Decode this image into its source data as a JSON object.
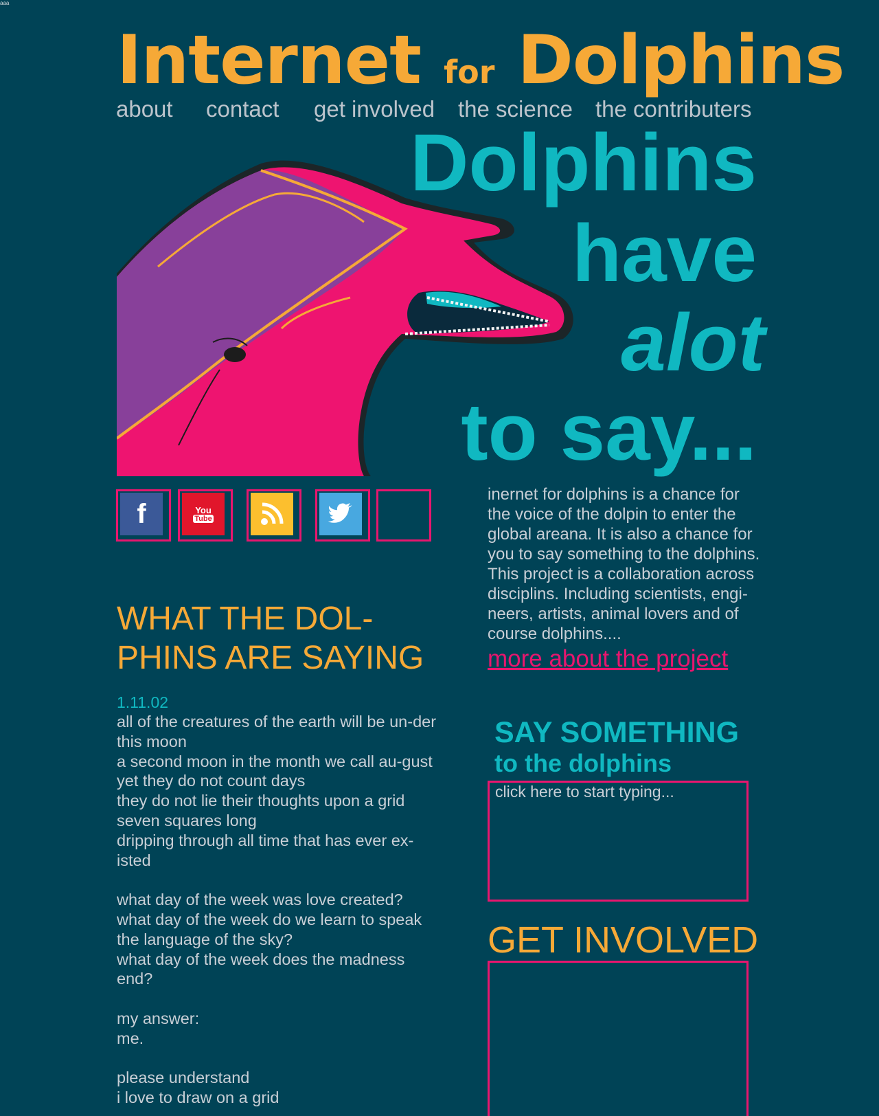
{
  "corner_text": "aaa",
  "logo": {
    "word1": "Internet",
    "word2": "for",
    "word3": "Dolphins"
  },
  "nav": [
    {
      "label": "about"
    },
    {
      "label": "contact"
    },
    {
      "label": "get involved"
    },
    {
      "label": "the science"
    },
    {
      "label": "the contributers"
    }
  ],
  "headline": {
    "line1": "Dolphins",
    "line2": "have",
    "line3": "alot",
    "line4": "to say..."
  },
  "social": [
    {
      "icon": "facebook-icon",
      "color": "#3b5998",
      "glyph": "f"
    },
    {
      "icon": "youtube-icon",
      "color": "#e1162b",
      "glyph_top": "You",
      "glyph_bottom": "Tube"
    },
    {
      "icon": "rss-icon",
      "color": "#fcbf2e"
    },
    {
      "icon": "twitter-icon",
      "color": "#48a8e0"
    },
    {
      "icon": "empty-slot"
    }
  ],
  "intro": {
    "text": "inernet for dolphins is a chance for the voice of the dolpin to enter the global areana. It is also a chance for you to say something to the dolphins. This project is a collaboration across disciplins. Including scientists, engi-neers, artists, animal lovers and of course dolphins....",
    "link": "more about the project"
  },
  "feed": {
    "title": "WHAT THE DOL-PHINS ARE SAYING",
    "date": "1.11.02",
    "poem": "all of the creatures of the earth will be un-der this moon\na second moon in the month we call au-gust\nyet they do not count days\nthey do not lie their thoughts upon a grid seven squares long\ndripping through all time that has ever ex-isted\n\nwhat day of the week was love created?\nwhat day of the week do we learn to speak the language of the sky?\nwhat day of the week does the madness end?\n\nmy answer:\nme.\n\nplease understand\ni love to draw on a grid"
  },
  "say": {
    "title": "SAY SOMETHING",
    "subtitle": "to the dolphins",
    "placeholder": "click here to start typing..."
  },
  "get_involved": {
    "title": "GET INVOLVED"
  },
  "colors": {
    "background": "#004356",
    "orange": "#f6a937",
    "teal": "#10b8c1",
    "pink": "#e8166e",
    "text": "#c8cfd6"
  }
}
